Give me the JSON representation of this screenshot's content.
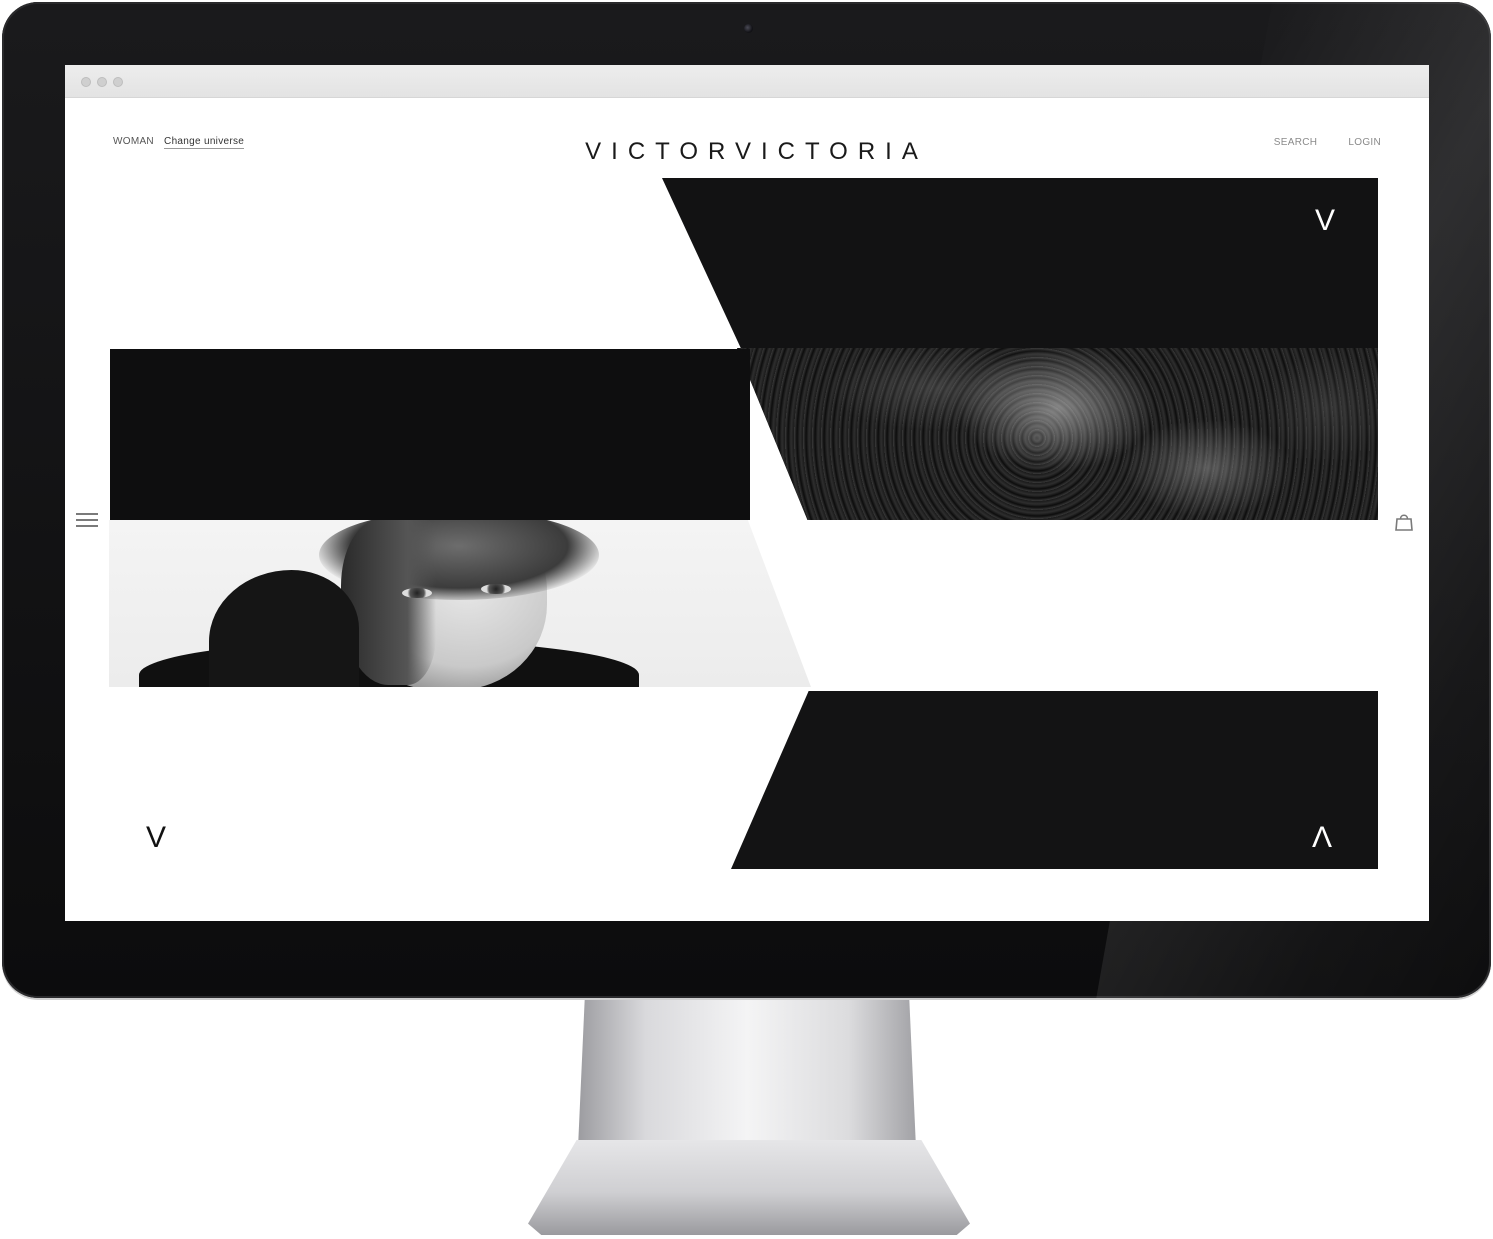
{
  "header": {
    "universe_current": "WOMAN",
    "change_universe": "Change universe",
    "logo": "VICTORVICTORIA",
    "search": "SEARCH",
    "login": "LOGIN"
  },
  "icons": {
    "menu": "hamburger-menu-icon",
    "bag": "shopping-bag-icon"
  },
  "chevrons": {
    "top_right": "V",
    "bottom_left": "V",
    "bottom_right": "Λ"
  },
  "colors": {
    "panel_black": "#121213",
    "screen_background": "#ffffff",
    "bezel": "#111111"
  }
}
